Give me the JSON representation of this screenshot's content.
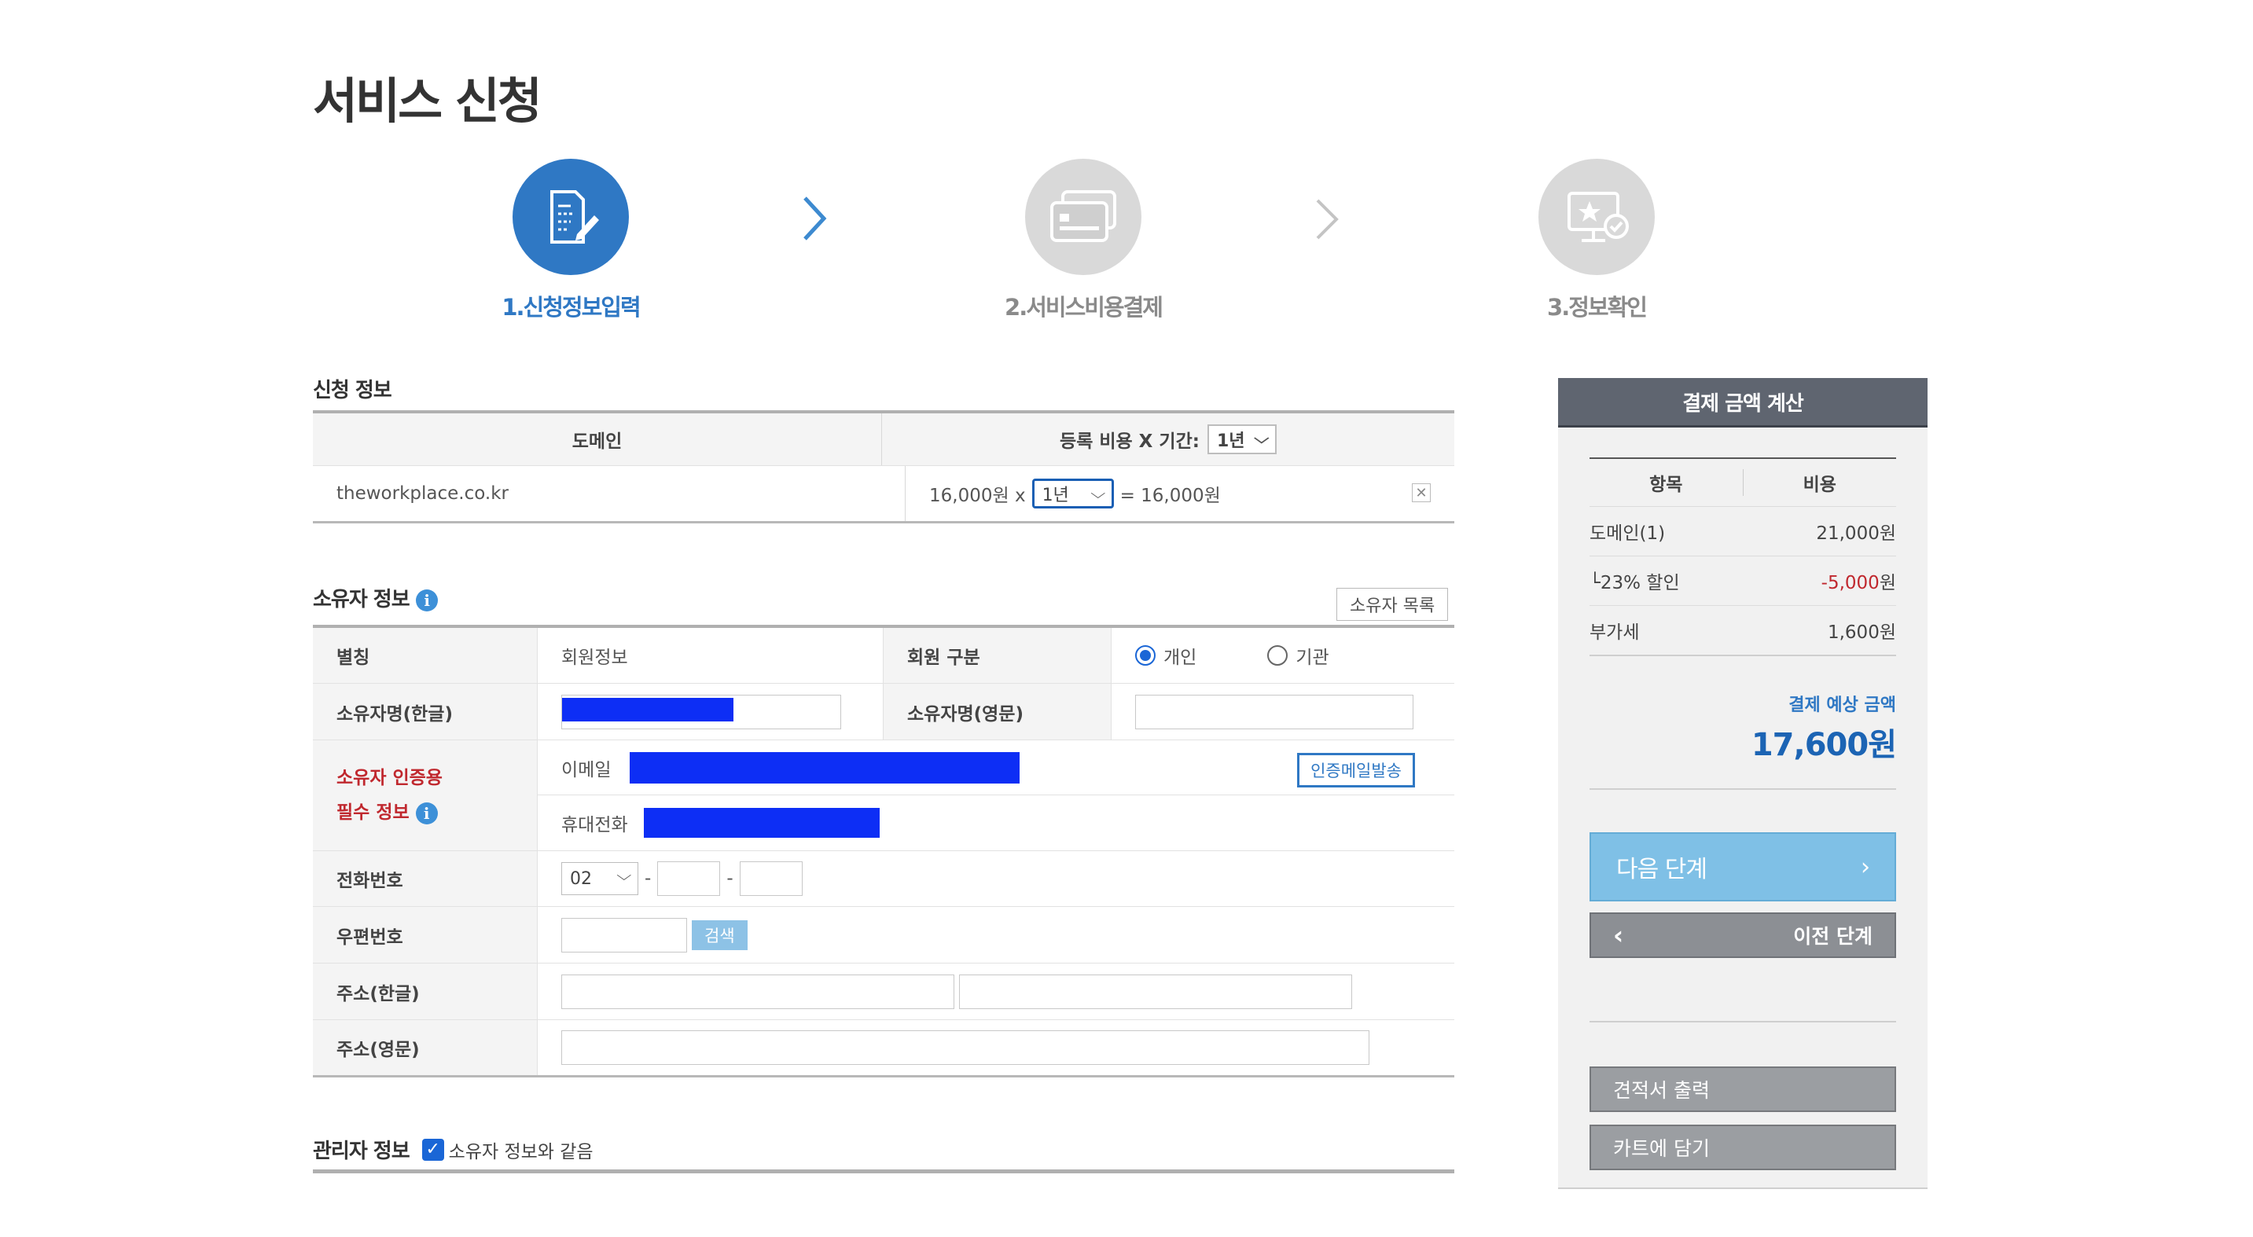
{
  "page": {
    "title": "서비스 신청"
  },
  "steps": [
    {
      "label": "1.신청정보입력",
      "state": "active"
    },
    {
      "label": "2.서비스비용결제",
      "state": "inactive"
    },
    {
      "label": "3.정보확인",
      "state": "inactive"
    }
  ],
  "application": {
    "section_title": "신청 정보",
    "header_domain": "도메인",
    "header_cost": "등록 비용 X 기간:",
    "header_period": "1년",
    "row": {
      "domain": "theworkplace.co.kr",
      "unit_price": "16,000원 x",
      "period": "1년",
      "total": "= 16,000원"
    }
  },
  "owner": {
    "section_title": "소유자 정보",
    "list_button": "소유자 목록",
    "alias_label": "별칭",
    "alias_value": "회원정보",
    "member_type_label": "회원 구분",
    "member_type_options": [
      "개인",
      "기관"
    ],
    "member_type_selected": "개인",
    "name_ko_label": "소유자명(한글)",
    "name_en_label": "소유자명(영문)",
    "verify_label_line1": "소유자 인증용",
    "verify_label_line2": "필수 정보",
    "email_label": "이메일",
    "send_mail_button": "인증메일발송",
    "mobile_label": "휴대전화",
    "phone_label": "전화번호",
    "phone_area": "02",
    "dash": "-",
    "zip_label": "우편번호",
    "search_button": "검색",
    "addr_ko_label": "주소(한글)",
    "addr_en_label": "주소(영문)"
  },
  "admin": {
    "section_title": "관리자 정보",
    "same_as_owner": "소유자 정보와 같음",
    "same_checked": true
  },
  "summary": {
    "title": "결제 금액 계산",
    "col_item": "항목",
    "col_cost": "비용",
    "rows": [
      {
        "item": "도메인(1)",
        "cost": "21,000원"
      },
      {
        "item": "└23% 할인",
        "cost": "-5,000",
        "unit": "원"
      },
      {
        "item": "부가세",
        "cost": "1,600원"
      }
    ],
    "expected_label": "결제 예상 금액",
    "expected_amount": "17,600원",
    "next_button": "다음 단계",
    "prev_button": "이전 단계",
    "quote_button": "견적서 출력",
    "cart_button": "카트에 담기"
  },
  "colors": {
    "accent": "#2f78c4",
    "discount": "#c0282e",
    "redaction": "#0d2ef5"
  }
}
